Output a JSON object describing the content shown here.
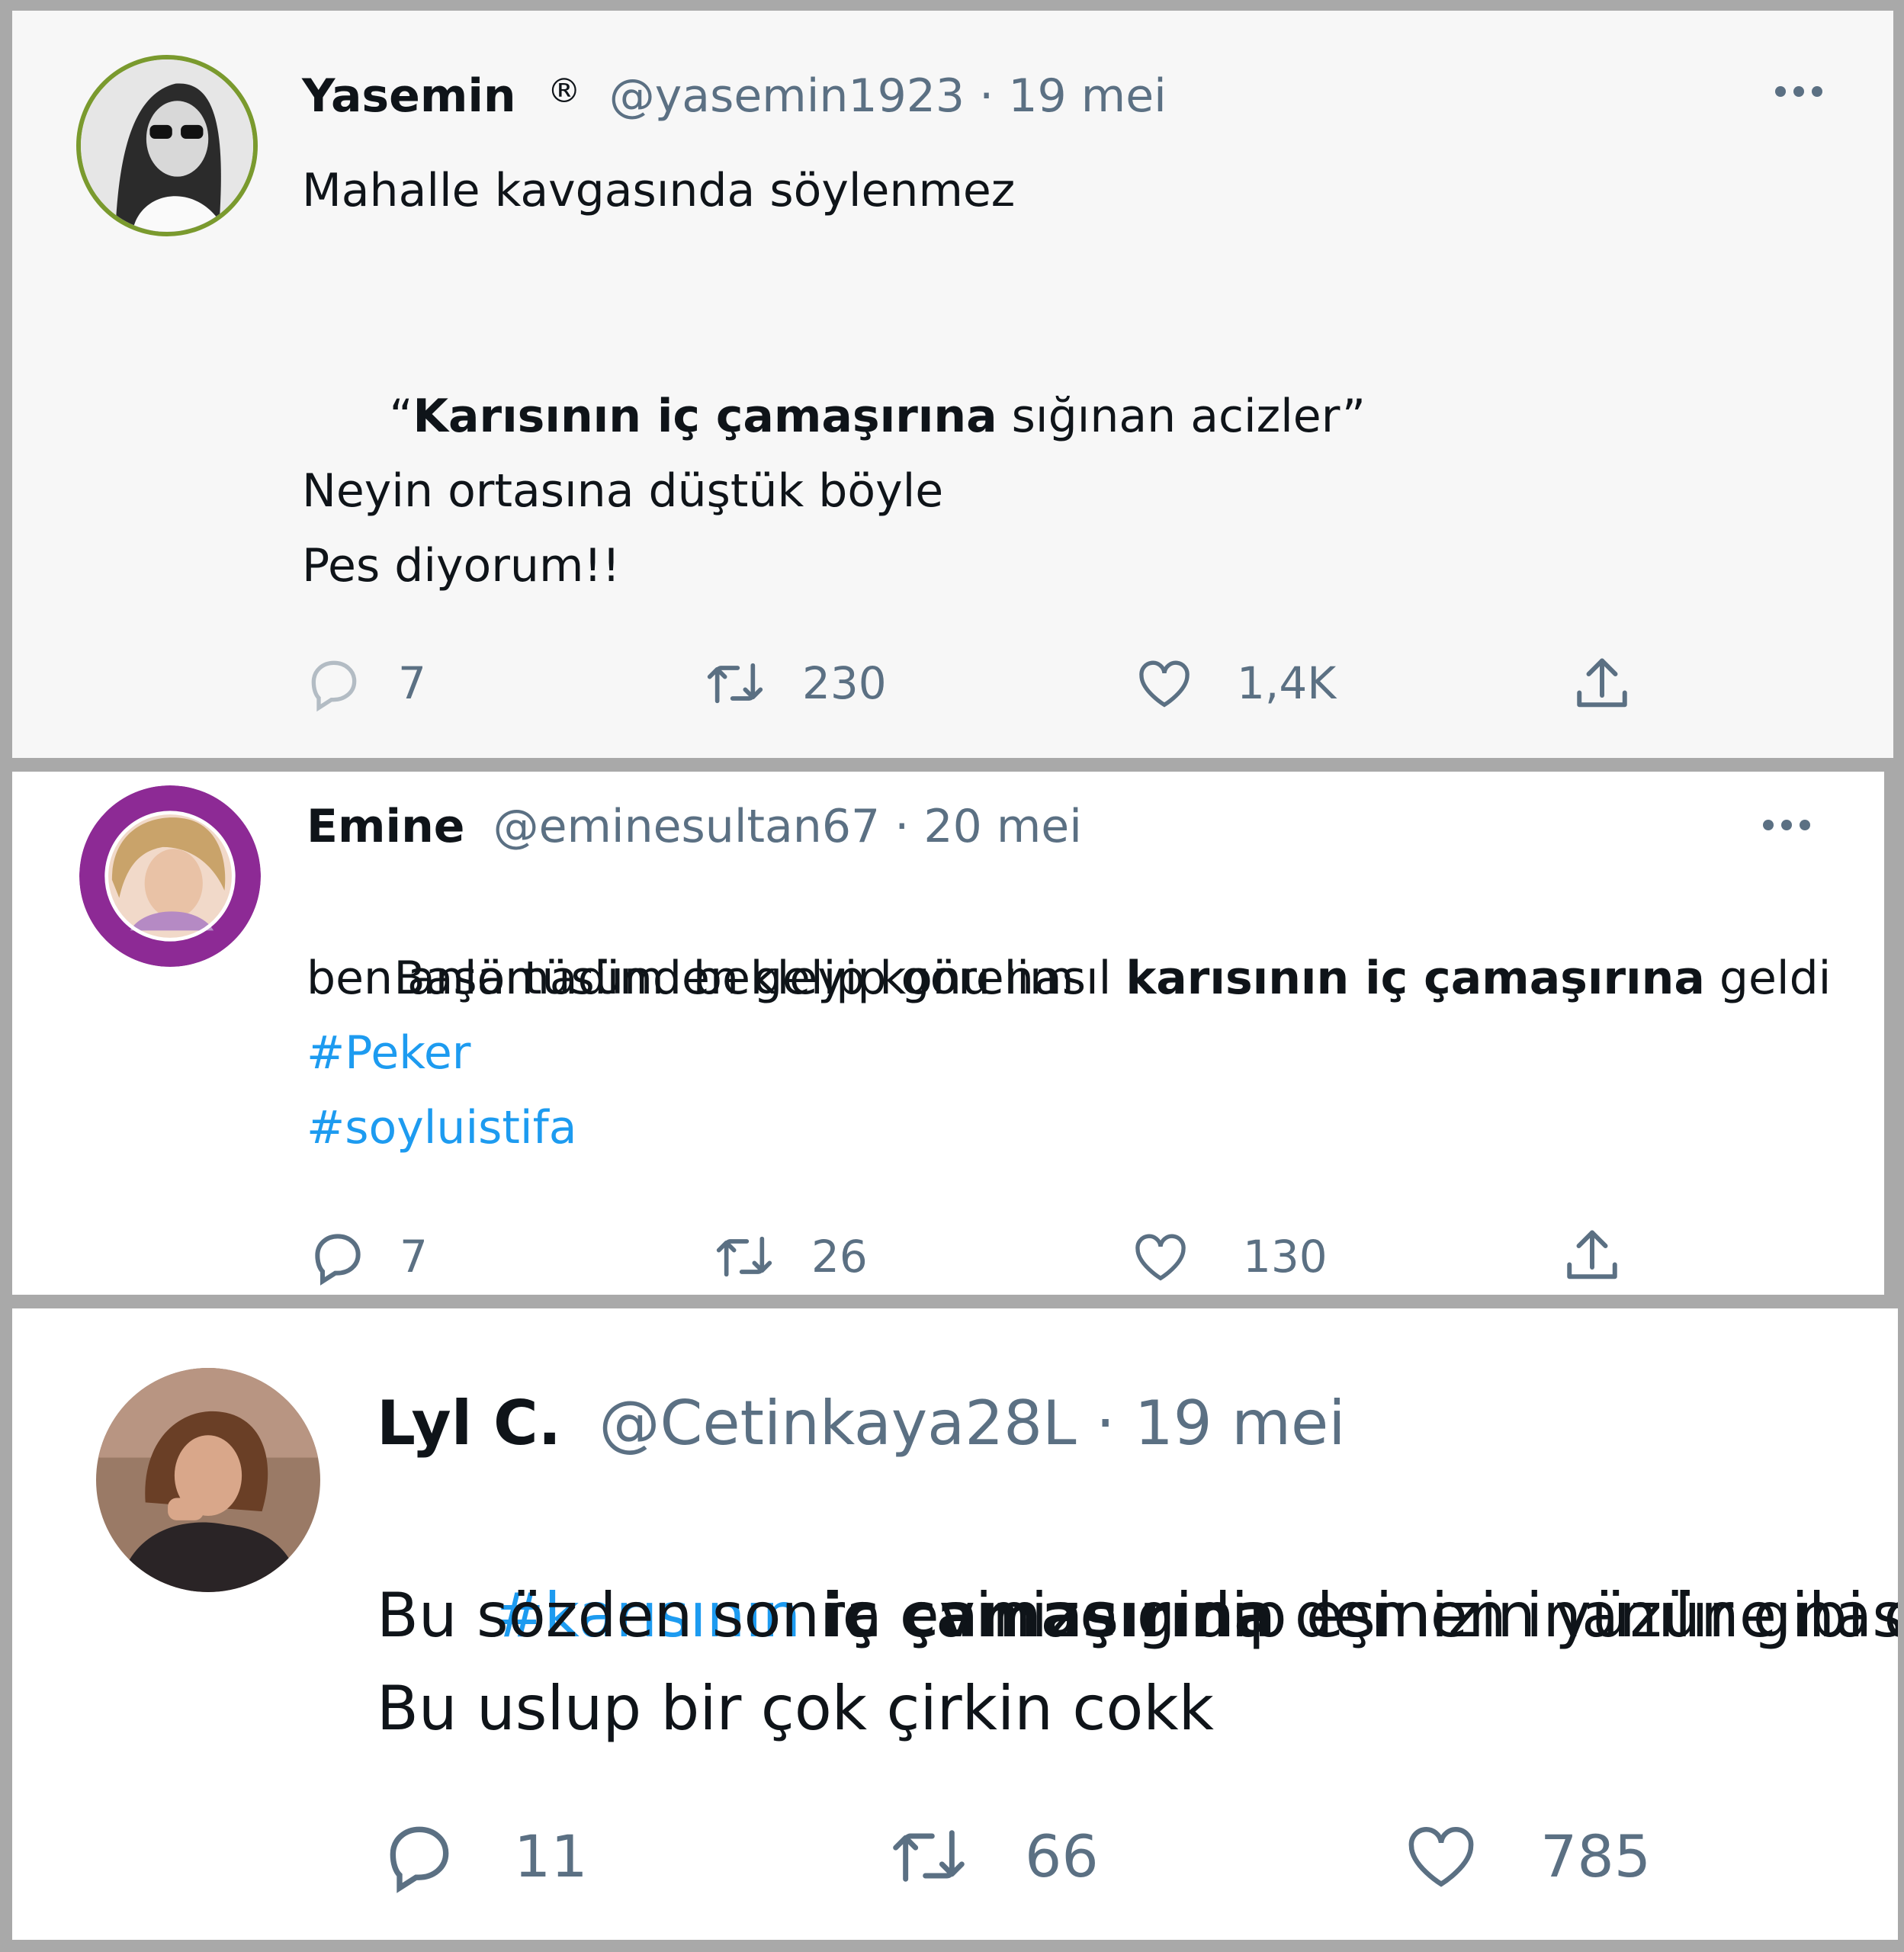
{
  "colors": {
    "text": "#0f1419",
    "muted": "#5b7083",
    "link": "#1d9bf0"
  },
  "tweets": [
    {
      "name": "Yasemin",
      "badge": "®",
      "handle": "@yasemin1923",
      "date": "19 mei",
      "line1": "Mahalle kavgasında söylenmez",
      "line2_open": "“",
      "line2_bold": "Karısının iç çamaşırına",
      "line2_rest": " sığınan acizler”",
      "line3": "Neyin ortasına düştük böyle",
      "line4": "Pes diyorum!!",
      "replies": "7",
      "retweets": "230",
      "likes": "1,4K",
      "icons": [
        "reply-icon",
        "retweet-icon",
        "like-icon",
        "share-icon",
        "more-icon"
      ]
    },
    {
      "name": "Emine",
      "handle": "@eminesultan67",
      "date": "20 mei",
      "line1_a": "Başörtüsünden gelip konu nasıl ",
      "line1_bold": "karısının iç çamaşırına",
      "line1_c": " geldi",
      "line2": "ben anlamadım  bekleyip görelim",
      "hashtag1": "#Peker",
      "hashtag2": "#soyluistifa",
      "replies": "7",
      "retweets": "26",
      "likes": "130",
      "icons": [
        "reply-icon",
        "retweet-icon",
        "like-icon",
        "share-icon",
        "more-icon"
      ]
    },
    {
      "name": "Lyl C.",
      "handle": "@Cetinkaya28L",
      "date": "19 mei",
      "line1_tag": "#karısının",
      "line1_bold": " iç çamaşırına",
      "line1_rest": " demen inanılır gibi değil.",
      "line2": "Bu sözden sonra evinize gidip eşinizin yüzüne nas",
      "line3": "Bu uslup bir çok çirkin cokk",
      "replies": "11",
      "retweets": "66",
      "likes": "785",
      "icons": [
        "reply-icon",
        "retweet-icon",
        "like-icon"
      ]
    }
  ]
}
